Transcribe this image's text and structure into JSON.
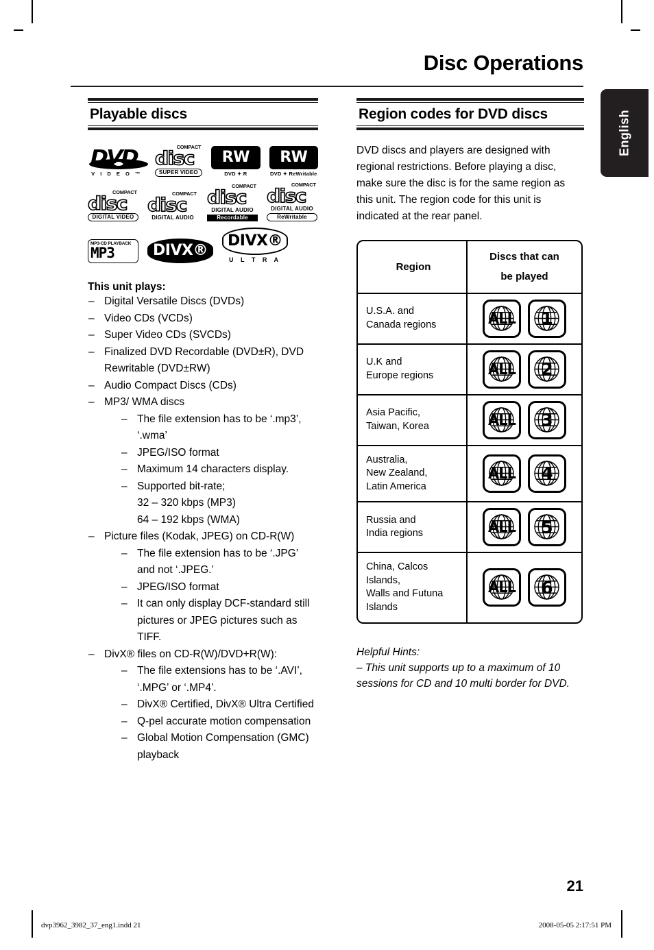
{
  "document": {
    "title": "Disc Operations",
    "language_tab": "English",
    "page_number": "21"
  },
  "footer": {
    "file_name": "dvp3962_3982_37_eng1.indd  21",
    "timestamp": "2008-05-05  2:17:51 PM"
  },
  "left_column": {
    "section_title": "Playable discs",
    "logos": [
      {
        "name": "dvd-video-logo",
        "word": "DVD",
        "sub": "V I D E O ™"
      },
      {
        "name": "svcd-logo",
        "top": "COMPACT",
        "disc": "disc",
        "band": "SUPER  VIDEO",
        "band_style": "outline"
      },
      {
        "name": "dvd-plus-r-logo",
        "chip": "RW",
        "sub": "DVD ✦ R"
      },
      {
        "name": "dvd-plus-rw-logo",
        "chip": "RW",
        "sub": "DVD ✦ ReWritable"
      },
      {
        "name": "cd-digital-video-logo",
        "top": "COMPACT",
        "disc": "disc",
        "band": "DIGITAL VIDEO",
        "band_style": "outline"
      },
      {
        "name": "cd-digital-audio-logo",
        "top": "COMPACT",
        "disc": "disc",
        "band": "DIGITAL AUDIO",
        "band_style": "plain"
      },
      {
        "name": "cd-recordable-logo",
        "top": "COMPACT",
        "disc": "disc",
        "band": "DIGITAL AUDIO",
        "band2": "Recordable",
        "band_style": "solid"
      },
      {
        "name": "cd-rewritable-logo",
        "top": "COMPACT",
        "disc": "disc",
        "band": "DIGITAL AUDIO",
        "band2": "ReWritable",
        "band_style": "outline"
      },
      {
        "name": "mp3-cd-playback-logo",
        "cap": "MP3-CD PLAYBACK",
        "dots": "MP3"
      },
      {
        "name": "divx-logo",
        "pill": "DIVX®"
      },
      {
        "name": "divx-ultra-logo",
        "pill": "DIVX®",
        "ultra": "U L T R A"
      }
    ],
    "lead_in": "This unit plays:",
    "items": [
      {
        "text": "Digital Versatile Discs (DVDs)"
      },
      {
        "text": "Video CDs (VCDs)"
      },
      {
        "text": "Super Video CDs (SVCDs)"
      },
      {
        "text": "Finalized DVD Recordable (DVD±R), DVD Rewritable (DVD±RW)"
      },
      {
        "text": "Audio Compact Discs (CDs)"
      },
      {
        "text": "MP3/ WMA discs",
        "sub": [
          {
            "text": "The file extension has to be ‘.mp3’, ‘.wma’"
          },
          {
            "text": "JPEG/ISO format"
          },
          {
            "text": "Maximum 14 characters display."
          },
          {
            "text": "Supported bit-rate;",
            "lines": [
              "32 – 320 kbps (MP3)",
              "64 – 192 kbps (WMA)"
            ]
          }
        ]
      },
      {
        "text": "Picture files (Kodak, JPEG) on CD-R(W)",
        "sub": [
          {
            "text": "The file extension has to be ‘.JPG’ and not ‘.JPEG.’"
          },
          {
            "text": "JPEG/ISO format"
          },
          {
            "text": "It can only display DCF-standard still pictures or JPEG pictures such as TIFF."
          }
        ]
      },
      {
        "text": "DivX® files on CD-R(W)/DVD+R(W):",
        "tight": true,
        "sub": [
          {
            "text": "The file extensions has to be ‘.AVI’, ‘.MPG’ or ‘.MP4’."
          },
          {
            "text": "DivX® Certified, DivX® Ultra Certified"
          },
          {
            "text": "Q-pel accurate motion compensation"
          },
          {
            "text": "Global Motion Compensation (GMC) playback"
          }
        ]
      }
    ],
    "dash": "–"
  },
  "right_column": {
    "section_title": "Region codes for DVD discs",
    "intro": "DVD discs and players are designed with regional restrictions. Before playing a disc, make sure the disc is for the same region as this unit. The region code for this unit is indicated at the rear panel.",
    "table": {
      "headers": [
        "Region",
        "Discs that can be played"
      ],
      "header_line1": "Discs that can",
      "header_line2": "be played",
      "rows": [
        {
          "region": "U.S.A. and\nCanada regions",
          "badges": [
            "ALL",
            "1"
          ]
        },
        {
          "region": "U.K and\nEurope regions",
          "badges": [
            "ALL",
            "2"
          ]
        },
        {
          "region": "Asia Pacific,\nTaiwan, Korea",
          "badges": [
            "ALL",
            "3"
          ]
        },
        {
          "region": "Australia,\nNew Zealand,\nLatin America",
          "badges": [
            "ALL",
            "4"
          ]
        },
        {
          "region": "Russia and\nIndia regions",
          "badges": [
            "ALL",
            "5"
          ]
        },
        {
          "region": "China, Calcos\nIslands,\nWalls and Futuna\nIslands",
          "badges": [
            "ALL",
            "6"
          ]
        }
      ]
    },
    "hints": {
      "label": "Helpful Hints:",
      "text": "–  This unit supports up to a maximum of 10 sessions for CD and 10 multi border for DVD."
    }
  }
}
